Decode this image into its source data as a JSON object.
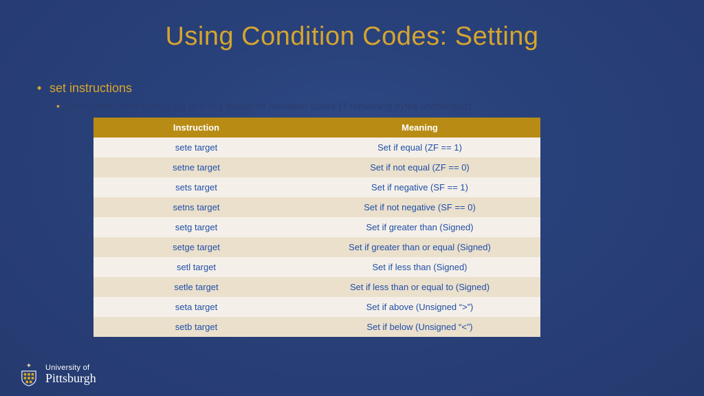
{
  "title": "Using Condition Codes: Setting",
  "bullet1": "set instructions",
  "bullet2_pre": "Sets lower order byte of ",
  "bullet2_dst": "dst",
  "bullet2_post": " to 0 or 1 based on condition codes (7 remaining bytes unchanged)",
  "table": {
    "headers": [
      "Instruction",
      "Meaning"
    ],
    "rows": [
      [
        "sete target",
        "Set if equal (ZF == 1)"
      ],
      [
        "setne target",
        "Set if not equal (ZF == 0)"
      ],
      [
        "sets target",
        "Set if negative (SF == 1)"
      ],
      [
        "setns target",
        "Set if not negative (SF == 0)"
      ],
      [
        "setg target",
        "Set if greater than (Signed)"
      ],
      [
        "setge target",
        "Set if greater than or equal (Signed)"
      ],
      [
        "setl target",
        "Set if less than (Signed)"
      ],
      [
        "setle target",
        "Set if less than or equal to (Signed)"
      ],
      [
        "seta target",
        "Set if above (Unsigned “>”)"
      ],
      [
        "setb target",
        "Set if below (Unsigned “<”)"
      ]
    ]
  },
  "footer": {
    "line1": "University of",
    "line2": "Pittsburgh"
  }
}
